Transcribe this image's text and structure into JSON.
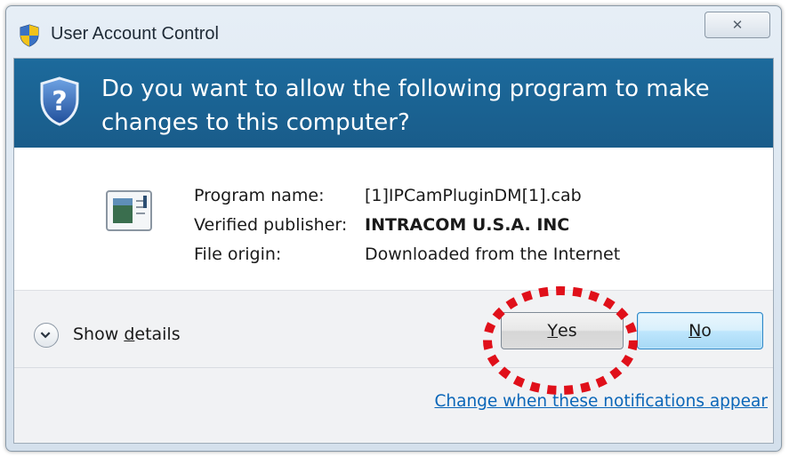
{
  "window": {
    "title": "User Account Control",
    "close_glyph": "✕"
  },
  "banner": {
    "question": "Do you want to allow the following program to make changes to this computer?"
  },
  "program_info": {
    "rows": [
      {
        "label": "Program name:",
        "value": "[1]IPCamPluginDM[1].cab",
        "bold": false
      },
      {
        "label": "Verified publisher:",
        "value": "INTRACOM U.S.A. INC",
        "bold": true
      },
      {
        "label": "File origin:",
        "value": "Downloaded from the Internet",
        "bold": false
      }
    ]
  },
  "footer": {
    "show_details_prefix": "Show ",
    "show_details_accel": "d",
    "show_details_suffix": "etails",
    "yes_accel": "Y",
    "yes_suffix": "es",
    "no_accel": "N",
    "no_suffix": "o",
    "notifications_link": "Change when these notifications appear"
  },
  "colors": {
    "banner": "#1c6a9c",
    "link": "#0a66b8",
    "highlight": "#e0101a"
  }
}
